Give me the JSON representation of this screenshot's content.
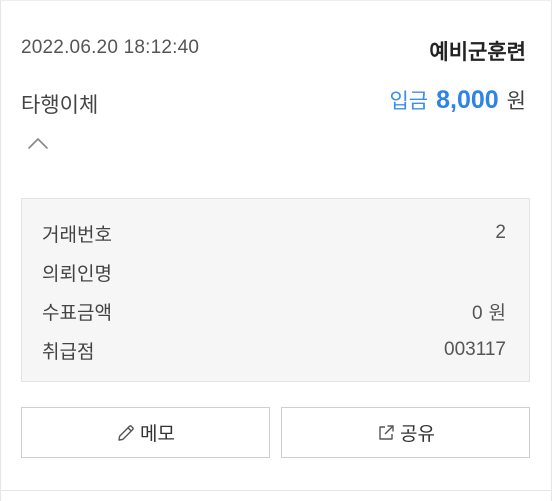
{
  "header": {
    "datetime": "2022.06.20  18:12:40",
    "memo_title": "예비군훈련"
  },
  "transaction": {
    "type_label": "타행이체",
    "amount_prefix": "입금",
    "amount_value": "8,000",
    "amount_unit": "원",
    "amount_color": "#2d84e6"
  },
  "toggle": {
    "icon": "chevron-up-icon"
  },
  "details": {
    "rows": [
      {
        "label": "거래번호",
        "value": "2",
        "unit": ""
      },
      {
        "label": "의뢰인명",
        "value": "",
        "unit": ""
      },
      {
        "label": "수표금액",
        "value": "0",
        "unit": "원"
      },
      {
        "label": "취급점",
        "value": "003117",
        "unit": ""
      }
    ]
  },
  "actions": {
    "memo_label": "메모",
    "memo_icon": "pencil-icon",
    "share_label": "공유",
    "share_icon": "external-link-icon"
  }
}
